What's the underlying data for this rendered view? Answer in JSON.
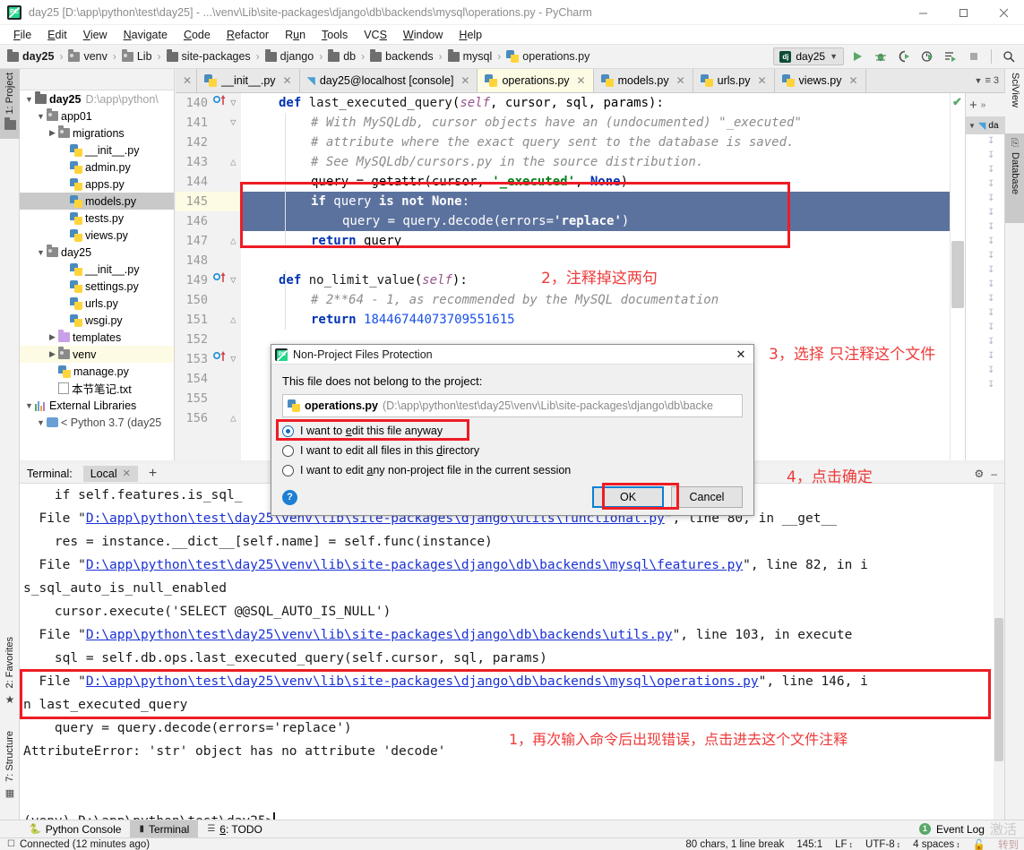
{
  "window": {
    "title": "day25 [D:\\app\\python\\test\\day25] - ...\\venv\\Lib\\site-packages\\django\\db\\backends\\mysql\\operations.py - PyCharm",
    "minimize": "—",
    "maximize": "□",
    "close": "✕",
    "logo_text": "PC"
  },
  "menubar": {
    "items": [
      "File",
      "Edit",
      "View",
      "Navigate",
      "Code",
      "Refactor",
      "Run",
      "Tools",
      "VCS",
      "Window",
      "Help"
    ]
  },
  "breadcrumb": {
    "items": [
      {
        "label": "day25",
        "icon": "folder-icon"
      },
      {
        "label": "venv",
        "icon": "folder-icon"
      },
      {
        "label": "Lib",
        "icon": "folder-icon"
      },
      {
        "label": "site-packages",
        "icon": "folder-icon"
      },
      {
        "label": "django",
        "icon": "folder-icon"
      },
      {
        "label": "db",
        "icon": "folder-icon"
      },
      {
        "label": "backends",
        "icon": "folder-icon"
      },
      {
        "label": "mysql",
        "icon": "folder-icon"
      },
      {
        "label": "operations.py",
        "icon": "python-file-icon"
      }
    ],
    "separator": "›"
  },
  "toolbar": {
    "run_config": "day25",
    "run_config_icon": "dj",
    "chevron": "∨",
    "buttons": [
      {
        "name": "run-button",
        "glyph": "▶"
      },
      {
        "name": "debug-button",
        "glyph": "🐞"
      },
      {
        "name": "run-coverage-button",
        "glyph": "▶"
      },
      {
        "name": "profile-button",
        "glyph": "▶"
      },
      {
        "name": "run-with-button",
        "glyph": "▶"
      },
      {
        "name": "stop-button",
        "glyph": "■"
      },
      {
        "name": "search-everywhere-icon",
        "glyph": "🔍"
      }
    ]
  },
  "left_strip": {
    "project": "1: Project",
    "favorites": "2: Favorites",
    "structure": "7: Structure"
  },
  "right_strip": {
    "sciview": "SciView",
    "database": "Database"
  },
  "project_tree": [
    {
      "depth": 0,
      "arrow": "∨",
      "icon": "folder-icon",
      "label": "day25",
      "bold": true,
      "path": "D:\\app\\python\\",
      "state": "normal"
    },
    {
      "depth": 1,
      "arrow": "∨",
      "icon": "module-folder-icon",
      "label": "app01",
      "state": "normal"
    },
    {
      "depth": 2,
      "arrow": "›",
      "icon": "module-folder-icon",
      "label": "migrations",
      "state": "normal"
    },
    {
      "depth": 3,
      "arrow": "",
      "icon": "python-file-icon",
      "label": "__init__.py",
      "state": "normal"
    },
    {
      "depth": 3,
      "arrow": "",
      "icon": "python-file-icon",
      "label": "admin.py",
      "state": "normal"
    },
    {
      "depth": 3,
      "arrow": "",
      "icon": "python-file-icon",
      "label": "apps.py",
      "state": "normal"
    },
    {
      "depth": 3,
      "arrow": "",
      "icon": "python-file-icon",
      "label": "models.py",
      "state": "selected"
    },
    {
      "depth": 3,
      "arrow": "",
      "icon": "python-file-icon",
      "label": "tests.py",
      "state": "normal"
    },
    {
      "depth": 3,
      "arrow": "",
      "icon": "python-file-icon",
      "label": "views.py",
      "state": "normal"
    },
    {
      "depth": 1,
      "arrow": "∨",
      "icon": "module-folder-icon",
      "label": "day25",
      "state": "normal"
    },
    {
      "depth": 3,
      "arrow": "",
      "icon": "python-file-icon",
      "label": "__init__.py",
      "state": "normal"
    },
    {
      "depth": 3,
      "arrow": "",
      "icon": "python-file-icon",
      "label": "settings.py",
      "state": "normal"
    },
    {
      "depth": 3,
      "arrow": "",
      "icon": "python-file-icon",
      "label": "urls.py",
      "state": "normal"
    },
    {
      "depth": 3,
      "arrow": "",
      "icon": "python-file-icon",
      "label": "wsgi.py",
      "state": "normal"
    },
    {
      "depth": 1,
      "arrow": "›",
      "icon": "templates-folder-icon",
      "label": "templates",
      "state": "normal"
    },
    {
      "depth": 1,
      "arrow": "›",
      "icon": "module-folder-icon",
      "label": "venv",
      "state": "highlighted"
    },
    {
      "depth": 2,
      "arrow": "",
      "icon": "python-file-icon",
      "label": "manage.py",
      "state": "normal"
    },
    {
      "depth": 2,
      "arrow": "",
      "icon": "text-file-icon",
      "label": "本节笔记.txt",
      "state": "normal"
    },
    {
      "depth": 0,
      "arrow": "∨",
      "icon": "external-libraries-icon",
      "label": "External Libraries",
      "state": "normal"
    },
    {
      "depth": 1,
      "arrow": "∨",
      "icon": "sdk-icon",
      "label": "< Python 3.7 (day25",
      "state": "normal"
    }
  ],
  "editor_tabs": [
    {
      "label": "__init__.py",
      "icon": "python-file-icon",
      "active": false
    },
    {
      "label": "day25@localhost [console]",
      "icon": "console-icon",
      "active": false
    },
    {
      "label": "operations.py",
      "icon": "python-file-icon",
      "active": true
    },
    {
      "label": "models.py",
      "icon": "python-file-icon",
      "active": false
    },
    {
      "label": "urls.py",
      "icon": "python-file-icon",
      "active": false
    },
    {
      "label": "views.py",
      "icon": "python-file-icon",
      "active": false
    }
  ],
  "editor_tab_overflow": "3",
  "editor": {
    "inspection_status": "✔",
    "lines": [
      {
        "no": "140",
        "marker": "method-run-marker",
        "fold": "−",
        "text": "def last_executed_query(self, cursor, sql, params):",
        "style": "def"
      },
      {
        "no": "141",
        "marker": "",
        "fold": "−",
        "text": "    # With MySQLdb, cursor objects have an (undocumented) \"_executed\"",
        "style": "comment"
      },
      {
        "no": "142",
        "marker": "",
        "fold": "",
        "text": "    # attribute where the exact query sent to the database is saved.",
        "style": "comment"
      },
      {
        "no": "143",
        "marker": "",
        "fold": "⌐",
        "text": "    # See MySQLdb/cursors.py in the source distribution.",
        "style": "comment"
      },
      {
        "no": "144",
        "marker": "",
        "fold": "",
        "text": "    query = getattr(cursor, '_executed', None)",
        "style": "code"
      },
      {
        "no": "145",
        "marker": "",
        "fold": "",
        "text": "    if query is not None:",
        "style": "selected"
      },
      {
        "no": "146",
        "marker": "",
        "fold": "",
        "text": "        query = query.decode(errors='replace')",
        "style": "selected"
      },
      {
        "no": "147",
        "marker": "",
        "fold": "⌐",
        "text": "    return query",
        "style": "code"
      },
      {
        "no": "148",
        "marker": "",
        "fold": "",
        "text": "",
        "style": "code"
      },
      {
        "no": "149",
        "marker": "method-run-marker",
        "fold": "−",
        "text": "def no_limit_value(self):",
        "style": "def"
      },
      {
        "no": "150",
        "marker": "",
        "fold": "",
        "text": "    # 2**64 - 1, as recommended by the MySQL documentation",
        "style": "comment"
      },
      {
        "no": "151",
        "marker": "",
        "fold": "⌐",
        "text": "    return 18446744073709551615",
        "style": "return-num"
      },
      {
        "no": "152",
        "marker": "",
        "fold": "",
        "text": "",
        "style": "code"
      },
      {
        "no": "153",
        "marker": "method-run-marker",
        "fold": "−",
        "text": "",
        "style": "code"
      },
      {
        "no": "154",
        "marker": "",
        "fold": "",
        "text": "",
        "style": "code"
      },
      {
        "no": "155",
        "marker": "",
        "fold": "",
        "text": "",
        "style": "code"
      },
      {
        "no": "156",
        "marker": "",
        "fold": "⌐",
        "text": "",
        "style": "code"
      }
    ],
    "code_tokens": {
      "l140": [
        "def ",
        "last_executed_query",
        "(",
        "self",
        ", cursor, sql, params):"
      ],
      "l144": [
        "        query = getattr(cursor, ",
        "'_executed'",
        ", ",
        "None",
        ")"
      ],
      "l145": [
        "        ",
        "if",
        " query ",
        "is not None",
        ":"
      ],
      "l146": [
        "            query = query.decode(errors=",
        "'replace'",
        ")"
      ],
      "l147": [
        "        ",
        "return",
        " query"
      ],
      "l149": [
        "def ",
        "no_limit_value",
        "(",
        "self",
        "):"
      ],
      "l151": [
        "        ",
        "return",
        " ",
        "18446744073709551615"
      ]
    }
  },
  "dialog": {
    "title": "Non-Project Files Protection",
    "close": "✕",
    "lead": "This file does not belong to the project:",
    "file_name": "operations.py",
    "file_path": "(D:\\app\\python\\test\\day25\\venv\\Lib\\site-packages\\django\\db\\backe",
    "options": [
      {
        "label": "I want to edit this file anyway",
        "selected": true
      },
      {
        "label": "I want to edit all files in this directory",
        "selected": false
      },
      {
        "label": "I want to edit any non-project file in the current session",
        "selected": false
      }
    ],
    "help": "?",
    "ok": "OK",
    "cancel": "Cancel"
  },
  "annotations": [
    {
      "id": "note2",
      "text": "2，注释掉这两句"
    },
    {
      "id": "note3",
      "text": "3，选择 只注释这个文件"
    },
    {
      "id": "note4",
      "text": "4，点击确定"
    },
    {
      "id": "note1",
      "text": "1，再次输入命令后出现错误，点击进去这个文件注释"
    }
  ],
  "terminal_panel": {
    "label": "Terminal:",
    "tab": "Local",
    "tab_close": "✕",
    "add": "+",
    "settings_icon": "gear-icon",
    "minimize_icon": "minimize-icon",
    "lines": [
      {
        "pre": "    if self.features.is_sql_",
        "link": "",
        "post": ""
      },
      {
        "pre": "  File \"",
        "link": "D:\\app\\python\\test\\day25\\venv\\lib\\site-packages\\django\\utils\\functional.py",
        "post": "\", line 80, in __get__"
      },
      {
        "pre": "    res = instance.__dict__[self.name] = self.func(instance)",
        "link": "",
        "post": ""
      },
      {
        "pre": "  File \"",
        "link": "D:\\app\\python\\test\\day25\\venv\\lib\\site-packages\\django\\db\\backends\\mysql\\features.py",
        "post": "\", line 82, in i"
      },
      {
        "pre": "s_sql_auto_is_null_enabled",
        "link": "",
        "post": ""
      },
      {
        "pre": "    cursor.execute('SELECT @@SQL_AUTO_IS_NULL')",
        "link": "",
        "post": ""
      },
      {
        "pre": "  File \"",
        "link": "D:\\app\\python\\test\\day25\\venv\\lib\\site-packages\\django\\db\\backends\\utils.py",
        "post": "\", line 103, in execute"
      },
      {
        "pre": "    sql = self.db.ops.last_executed_query(self.cursor, sql, params)",
        "link": "",
        "post": ""
      },
      {
        "pre": "  File \"",
        "link": "D:\\app\\python\\test\\day25\\venv\\lib\\site-packages\\django\\db\\backends\\mysql\\operations.py",
        "post": "\", line 146, i"
      },
      {
        "pre": "n last_executed_query",
        "link": "",
        "post": ""
      },
      {
        "pre": "    query = query.decode(errors='replace')",
        "link": "",
        "post": ""
      },
      {
        "pre": "AttributeError: 'str' object has no attribute 'decode'",
        "link": "",
        "post": ""
      },
      {
        "pre": "",
        "link": "",
        "post": ""
      },
      {
        "pre": "",
        "link": "",
        "post": ""
      },
      {
        "pre": "(venv) D:\\app\\python\\test\\day25>",
        "link": "",
        "post": ""
      }
    ]
  },
  "bottom_tabs": [
    {
      "label": "Python Console",
      "icon": "python-console-icon",
      "selected": false
    },
    {
      "label": "Terminal",
      "icon": "terminal-icon",
      "selected": true
    },
    {
      "label": "6: TODO",
      "icon": "todo-icon",
      "selected": false
    }
  ],
  "event_log": {
    "count": "1",
    "label": "Event Log"
  },
  "statusbar": {
    "connected": "Connected (12 minutes ago)",
    "chars": "80 chars, 1 line break",
    "caret": "145:1",
    "line_sep": "LF",
    "encoding": "UTF-8",
    "indent": "4 spaces",
    "lock_icon": "lock-icon",
    "stepper": "↕"
  },
  "watermark": {
    "text": "激活",
    "text2": "转到"
  },
  "colors": {
    "accent_red": "#ee1c25",
    "annotation_red": "#ee3a3a",
    "selection_blue": "#5c729e",
    "link_blue": "#1a31d5",
    "keyword_blue": "#0033b3",
    "comment_gray": "#8c8c8c",
    "string_green": "#067d17",
    "highlight_yellow": "#fdfbe3"
  }
}
